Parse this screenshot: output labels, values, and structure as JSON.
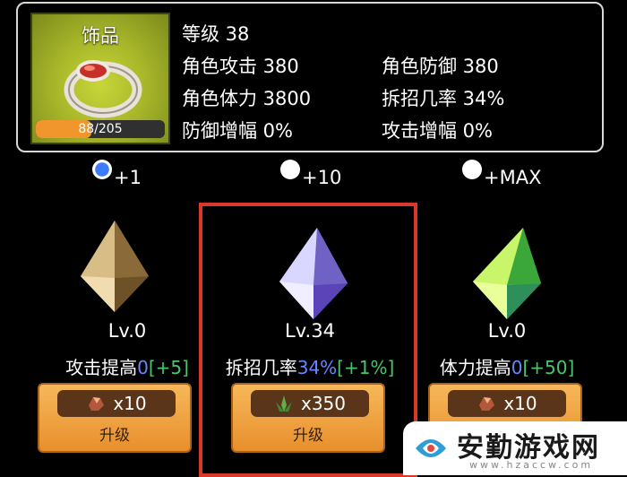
{
  "item": {
    "name": "饰品",
    "xp_text": "88/205",
    "xp_current": 88,
    "xp_max": 205,
    "icon": "ring-icon"
  },
  "stats": {
    "level": "等级 38",
    "attack": "角色攻击 380",
    "defense": "角色防御 380",
    "hp": "角色体力 3800",
    "parry": "拆招几率 34%",
    "def_boost": "防御增幅 0%",
    "atk_boost": "攻击增幅 0%"
  },
  "radios": [
    {
      "label": "+1",
      "selected": true
    },
    {
      "label": "+10",
      "selected": false
    },
    {
      "label": "+MAX",
      "selected": false
    }
  ],
  "cards": [
    {
      "level": "Lv.0",
      "effect_name": "攻击提高",
      "effect_val": "0",
      "effect_bonus": "[+5]",
      "cost": "x10",
      "cost_icon": "ore-icon",
      "button": "升级",
      "crystal": "gold-crystal-icon"
    },
    {
      "level": "Lv.34",
      "effect_name": "拆招几率",
      "effect_val": "34%",
      "effect_bonus": "[+1%]",
      "cost": "x350",
      "cost_icon": "herb-icon",
      "button": "升级",
      "crystal": "purple-crystal-icon"
    },
    {
      "level": "Lv.0",
      "effect_name": "体力提高",
      "effect_val": "0",
      "effect_bonus": "[+50]",
      "cost": "x10",
      "cost_icon": "ore-icon",
      "button": "升级",
      "crystal": "green-crystal-icon"
    }
  ],
  "watermark": {
    "text": "安勤游戏网",
    "url": "www.hzaccw.com"
  },
  "colors": {
    "accent_blue": "#6a86ff",
    "accent_green": "#47c66a",
    "select_frame": "#d8392b",
    "button_orange": "#e88f2c"
  }
}
